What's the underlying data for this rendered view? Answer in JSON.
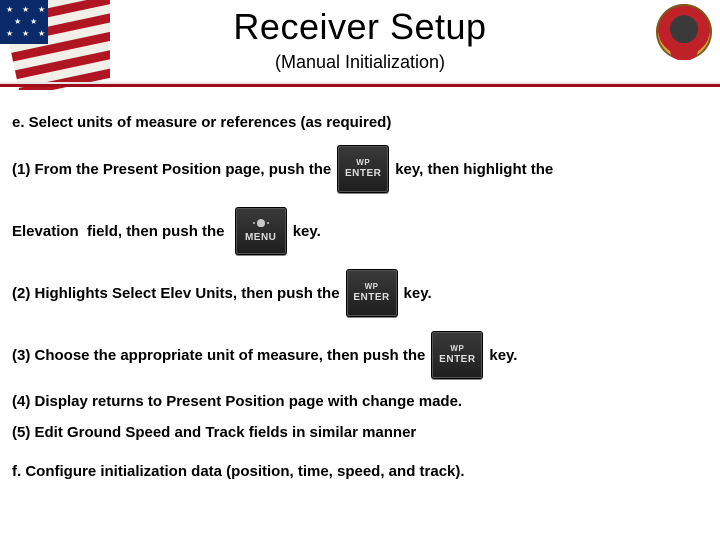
{
  "header": {
    "title": "Receiver Setup",
    "subtitle": "(Manual Initialization)"
  },
  "keys": {
    "enter_top": "WP",
    "enter_main": "ENTER",
    "menu_main": "MENU"
  },
  "body": {
    "section_e": "e. Select units of measure or references (as required)",
    "r1a": "(1) From the Present Position page, push the",
    "r1b": "key, then highlight the",
    "r2a": "Elevation  field, then push the ",
    "r2b": "key.",
    "r3a": "(2) Highlights Select Elev Units, then push the",
    "r3b": "key.",
    "r4a": "(3) Choose the appropriate unit of measure, then push the",
    "r4b": "key.",
    "r5": "(4) Display returns to Present Position page with change made.",
    "r6": "(5) Edit Ground Speed and Track fields in similar manner",
    "section_f": "f. Configure initialization data (position, time, speed, and track)."
  }
}
